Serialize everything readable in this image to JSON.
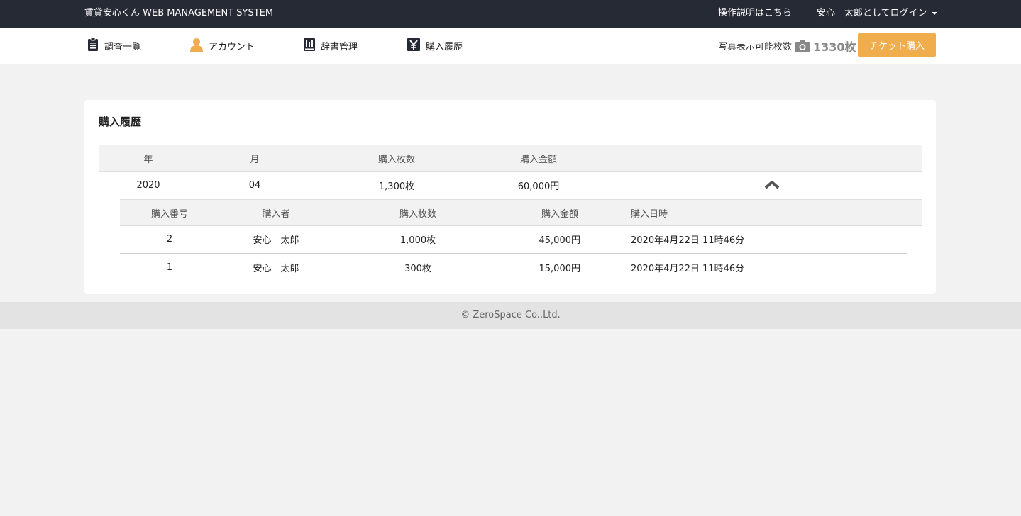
{
  "topbar": {
    "brand": "賃貸安心くん WEB MANAGEMENT SYSTEM",
    "help": "操作説明はこちら",
    "user": "安心　太郎としてログイン"
  },
  "nav": {
    "items": [
      {
        "label": "調査一覧",
        "icon": "clipboard-icon"
      },
      {
        "label": "アカウント",
        "icon": "user-icon"
      },
      {
        "label": "辞書管理",
        "icon": "book-icon"
      },
      {
        "label": "購入履歴",
        "icon": "yen-icon"
      }
    ],
    "photo_label": "写真表示可能枚数",
    "photo_count": "1330枚",
    "buy_button": "チケット購入"
  },
  "panel": {
    "title": "購入履歴",
    "headers": [
      "年",
      "月",
      "購入枚数",
      "購入金額"
    ],
    "rows": [
      {
        "year": "2020",
        "month": "04",
        "count": "1,300枚",
        "amount": "60,000円"
      }
    ],
    "sub_headers": [
      "購入番号",
      "購入者",
      "購入枚数",
      "購入金額",
      "購入日時"
    ],
    "sub_rows": [
      {
        "no": "2",
        "buyer": "安心　太郎",
        "count": "1,000枚",
        "amount": "45,000円",
        "date": "2020年4月22日 11時46分"
      },
      {
        "no": "1",
        "buyer": "安心　太郎",
        "count": "300枚",
        "amount": "15,000円",
        "date": "2020年4月22日 11時46分"
      }
    ]
  },
  "footer": "© ZeroSpace Co.,Ltd.",
  "colors": {
    "topbar": "#262a35",
    "accent": "#f0ad4e",
    "user_icon": "#f0ad4e"
  }
}
